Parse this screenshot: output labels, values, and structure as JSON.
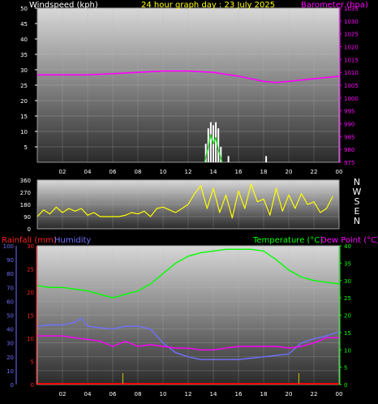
{
  "header": {
    "title": "24 hour graph day : 23 July 2025",
    "wind_label": "Windspeed (kph)",
    "baro_label": "Barometer (hpa)"
  },
  "lower_header": {
    "rain_label": "Rainfall (mm)",
    "humidity_label": "Humidity",
    "temp_label": "Temperature (°C)",
    "dew_label": "Dew Point (°C)"
  },
  "colors": {
    "title": "#ffff00",
    "wind": "#ffffff",
    "baro": "#ff00ff",
    "direction": "#ffff00",
    "rain": "#ff0000",
    "humidity": "#7070ff",
    "temperature": "#00ff00",
    "dewpoint": "#ff00ff"
  },
  "chart_data": [
    {
      "type": "line",
      "name": "wind-baro",
      "x_ticks": [
        "02",
        "04",
        "06",
        "08",
        "10",
        "12",
        "14",
        "16",
        "18",
        "20",
        "22",
        "00"
      ],
      "ylim_left": [
        0,
        50
      ],
      "ylim_right": [
        975,
        1035
      ],
      "yticks_left": [
        5,
        10,
        15,
        20,
        25,
        30,
        35,
        40,
        45,
        50
      ],
      "yticks_right": [
        975,
        980,
        985,
        990,
        995,
        1000,
        1005,
        1010,
        1015,
        1020,
        1025,
        1030,
        1035
      ],
      "barometer": {
        "x": [
          0,
          2,
          4,
          6,
          8,
          10,
          12,
          14,
          16,
          18,
          19,
          20,
          22,
          24
        ],
        "y": [
          1009,
          1009,
          1009,
          1009.5,
          1010,
          1010.5,
          1010.5,
          1010,
          1008.5,
          1006.5,
          1006,
          1006.5,
          1007.5,
          1008.5
        ]
      },
      "wind_gust": {
        "x": [
          13.4,
          13.6,
          13.8,
          14.0,
          14.2,
          14.4,
          14.6,
          15.2,
          18.2
        ],
        "y": [
          6,
          11,
          13,
          12,
          13,
          11,
          5,
          2,
          2
        ]
      },
      "wind_avg": {
        "x": [
          13.3,
          13.6,
          13.8,
          14.0,
          14.2,
          14.4,
          14.7
        ],
        "y": [
          0,
          5,
          9,
          6,
          8,
          4,
          0
        ]
      }
    },
    {
      "type": "scatter",
      "name": "wind-direction",
      "ylim": [
        0,
        360
      ],
      "yticks": [
        0,
        90,
        180,
        270,
        360
      ],
      "compass": [
        "N",
        "W",
        "S",
        "E",
        "N"
      ],
      "directions": {
        "x": [
          0,
          0.5,
          1,
          1.5,
          2,
          2.5,
          3,
          3.5,
          4,
          4.5,
          5,
          5.5,
          6,
          6.5,
          7,
          7.5,
          8,
          8.5,
          9,
          9.5,
          10,
          10.5,
          11,
          11.5,
          12,
          12.5,
          13,
          13.5,
          14,
          14.5,
          15,
          15.5,
          16,
          16.5,
          17,
          17.5,
          18,
          18.5,
          19,
          19.5,
          20,
          20.5,
          21,
          21.5,
          22,
          22.5,
          23,
          23.5
        ],
        "y": [
          90,
          140,
          110,
          160,
          120,
          150,
          130,
          150,
          100,
          120,
          90,
          90,
          90,
          90,
          100,
          120,
          110,
          130,
          90,
          150,
          160,
          140,
          120,
          150,
          180,
          260,
          320,
          150,
          300,
          120,
          250,
          80,
          280,
          150,
          330,
          200,
          220,
          100,
          300,
          130,
          250,
          150,
          260,
          180,
          200,
          120,
          150,
          240
        ]
      }
    },
    {
      "type": "line",
      "name": "temp-humidity-rain",
      "x_ticks": [
        "02",
        "04",
        "06",
        "08",
        "10",
        "12",
        "14",
        "16",
        "18",
        "20",
        "22",
        "00"
      ],
      "ylim_humidity": [
        0,
        100
      ],
      "yticks_humidity": [
        0,
        10,
        20,
        30,
        40,
        50,
        60,
        70,
        80,
        90,
        100
      ],
      "ylim_rain": [
        0,
        30
      ],
      "yticks_rain": [
        0,
        5,
        10,
        15,
        20,
        25,
        30
      ],
      "ylim_temp": [
        0,
        40
      ],
      "yticks_temp": [
        0,
        5,
        10,
        15,
        20,
        25,
        30,
        35,
        40
      ],
      "temperature": {
        "x": [
          0,
          1,
          2,
          3,
          4,
          5,
          6,
          7,
          8,
          9,
          10,
          11,
          12,
          13,
          14,
          15,
          16,
          17,
          18,
          19,
          20,
          21,
          22,
          23,
          24
        ],
        "y": [
          28.5,
          28,
          28,
          27.5,
          27,
          26,
          25,
          26,
          27,
          29,
          32,
          35,
          37,
          38,
          38.5,
          39,
          39,
          39,
          38.5,
          36,
          33,
          31,
          30,
          29.5,
          29
        ]
      },
      "humidity": {
        "x": [
          0,
          1,
          2,
          3,
          3.5,
          4,
          5,
          6,
          7,
          8,
          9,
          10,
          11,
          12,
          13,
          14,
          15,
          16,
          17,
          18,
          19,
          20,
          21,
          22,
          23,
          24
        ],
        "y": [
          42,
          43,
          43,
          45,
          48,
          42,
          41,
          40,
          42,
          42,
          40,
          30,
          23,
          20,
          18,
          18,
          18,
          18,
          19,
          20,
          21,
          22,
          30,
          33,
          35,
          38
        ]
      },
      "dewpoint": {
        "x": [
          0,
          1,
          2,
          3,
          4,
          5,
          6,
          7,
          8,
          9,
          10,
          11,
          12,
          13,
          14,
          15,
          16,
          17,
          18,
          19,
          20,
          21,
          22,
          23,
          24
        ],
        "y": [
          14,
          14,
          14,
          13.5,
          13,
          12.5,
          11,
          12.5,
          11,
          11.5,
          11,
          10.5,
          10.5,
          10,
          10,
          10.5,
          11,
          11,
          11,
          11,
          10.5,
          11,
          12,
          13.5,
          13.5
        ]
      },
      "rain": {
        "x": [
          6.8,
          20.8
        ],
        "y": [
          0.5,
          0.5
        ]
      }
    }
  ]
}
